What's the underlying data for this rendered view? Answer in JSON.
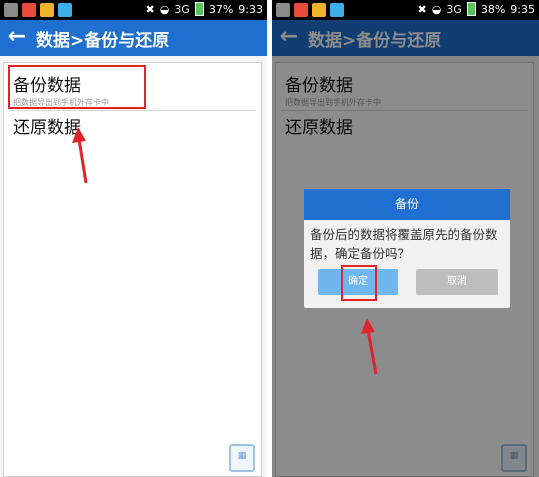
{
  "left": {
    "status": {
      "battery": "37%",
      "time": "9:33",
      "network": "3G"
    },
    "title": "数据>备份与还原",
    "items": [
      {
        "title": "备份数据",
        "subtitle": "把数据导出到手机外存卡中"
      },
      {
        "title": "还原数据"
      }
    ]
  },
  "right": {
    "status": {
      "battery": "38%",
      "time": "9:35",
      "network": "3G"
    },
    "title": "数据>备份与还原",
    "items": [
      {
        "title": "备份数据",
        "subtitle": "把数据导出到手机外存卡中"
      },
      {
        "title": "还原数据"
      }
    ],
    "dialog": {
      "title": "备份",
      "message": "备份后的数据将覆盖原先的备份数据，确定备份吗？",
      "ok_label": "确定",
      "cancel_label": "取消"
    }
  },
  "colors": {
    "accent": "#1e6fd0",
    "highlight": "#e0242b"
  }
}
